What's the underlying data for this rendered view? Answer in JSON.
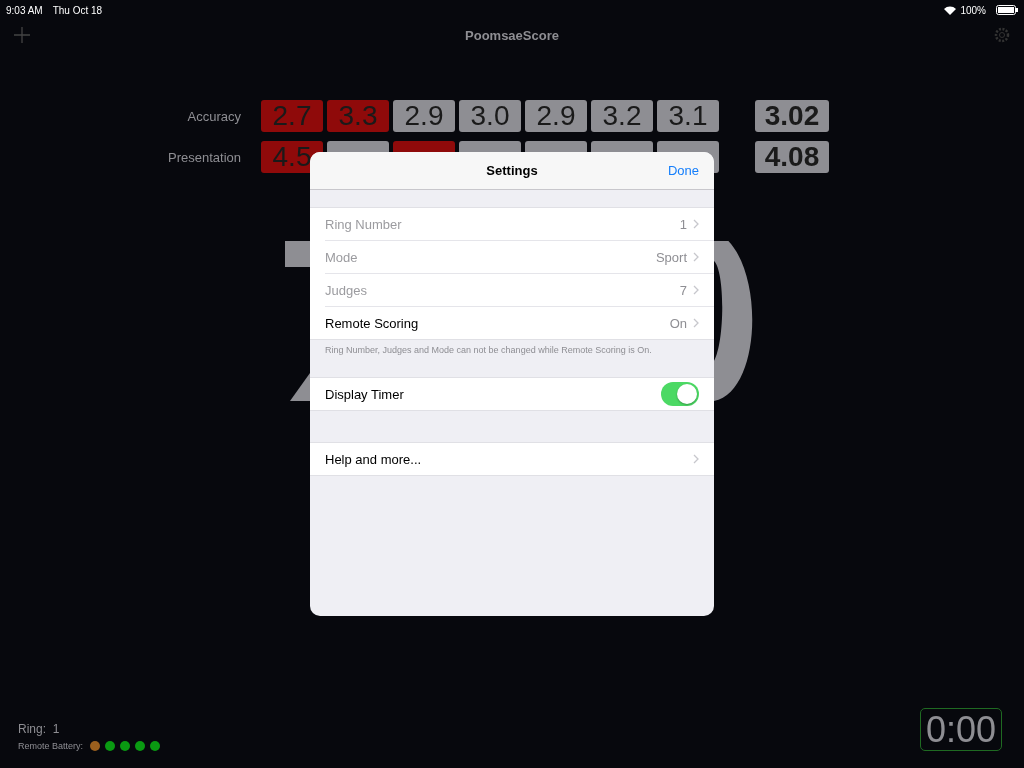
{
  "status_bar": {
    "time": "9:03 AM",
    "date": "Thu Oct 18",
    "battery": "100%"
  },
  "nav_bar": {
    "title": "PoomsaeScore"
  },
  "scores": [
    {
      "label": "Accuracy",
      "judges": [
        {
          "value": "2.7",
          "dropped": true
        },
        {
          "value": "3.3",
          "dropped": true
        },
        {
          "value": "2.9",
          "dropped": false
        },
        {
          "value": "3.0",
          "dropped": false
        },
        {
          "value": "2.9",
          "dropped": false
        },
        {
          "value": "3.2",
          "dropped": false
        },
        {
          "value": "3.1",
          "dropped": false
        }
      ],
      "average": "3.02"
    },
    {
      "label": "Presentation",
      "judges": [
        {
          "value": "4.5",
          "dropped": true
        },
        {
          "dropped": false
        },
        {
          "dropped": true
        },
        {
          "dropped": false
        },
        {
          "dropped": false
        },
        {
          "dropped": false
        },
        {
          "dropped": false
        }
      ],
      "average": "4.08"
    }
  ],
  "footer": {
    "ring_label": "Ring:",
    "ring_value": "1",
    "battery_label": "Remote Battery:",
    "battery_dots": [
      {
        "color": "#9a5f1e"
      },
      {
        "color": "#0a9a12"
      },
      {
        "color": "#0a9a12"
      },
      {
        "color": "#0a9a12"
      },
      {
        "color": "#0a9a12"
      }
    ],
    "timer": "0:00"
  },
  "settings": {
    "title": "Settings",
    "done": "Done",
    "sections": [
      {
        "rows": [
          {
            "kind": "disclosure",
            "label": "Ring Number",
            "value": "1",
            "disabled": true
          },
          {
            "kind": "disclosure",
            "label": "Mode",
            "value": "Sport",
            "disabled": true
          },
          {
            "kind": "disclosure",
            "label": "Judges",
            "value": "7",
            "disabled": true
          },
          {
            "kind": "disclosure",
            "label": "Remote Scoring",
            "value": "On",
            "disabled": false
          }
        ],
        "footer": "Ring Number, Judges and Mode can not be changed while Remote Scoring is On."
      },
      {
        "rows": [
          {
            "kind": "switch",
            "label": "Display Timer",
            "on": true
          }
        ]
      },
      {
        "rows": [
          {
            "kind": "disclosure",
            "label": "Help and more...",
            "disabled": false
          }
        ]
      }
    ]
  }
}
